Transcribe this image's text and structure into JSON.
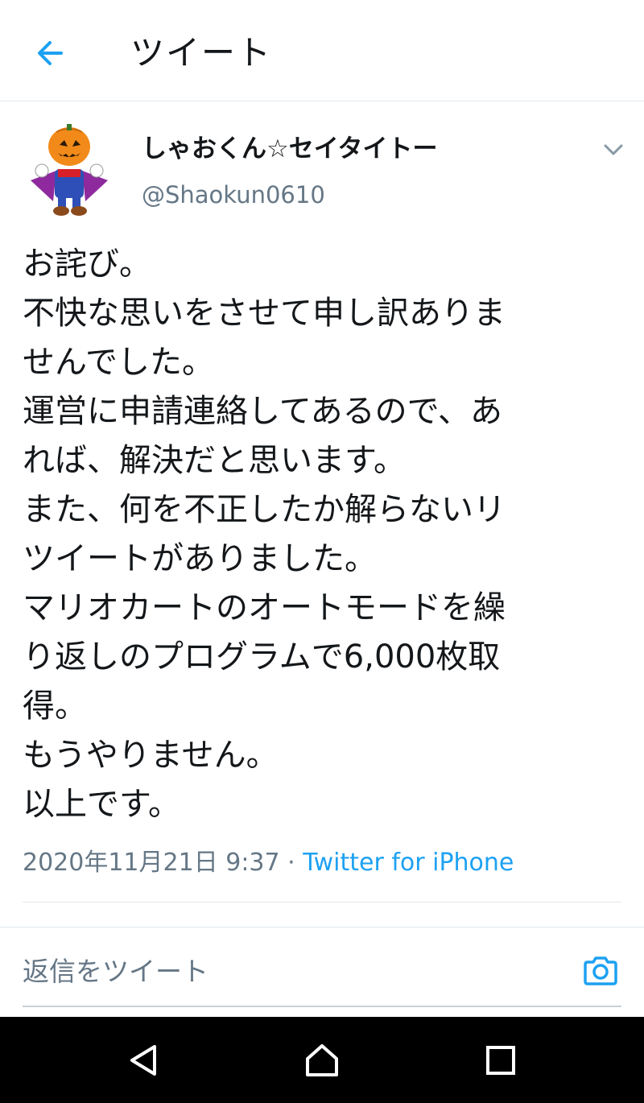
{
  "header": {
    "back_icon": "arrow-left-icon",
    "title": "ツイート"
  },
  "colors": {
    "accent": "#1da1f2",
    "secondary_text": "#657786",
    "divider": "#e1e8ed",
    "navbar": "#000000"
  },
  "tweet": {
    "avatar_icon": "pumpkin-mario-avatar",
    "display_name": "しゃおくん☆セイタイトー",
    "username": "@Shaokun0610",
    "menu_icon": "chevron-down-icon",
    "lines": [
      "お詫び。",
      "不快な思いをさせて申し訳ありま",
      "せんでした。",
      "運営に申請連絡してあるので、あ",
      "れば、解決だと思います。",
      "また、何を不正したか解らないリ",
      "ツイートがありました。",
      "マリオカートのオートモードを繰",
      "り返しのプログラムで6,000枚取",
      "得。",
      "もうやりません。",
      "以上です。"
    ],
    "timestamp": "2020年11月21日 9:37",
    "separator": "·",
    "source": "Twitter for iPhone"
  },
  "reply": {
    "placeholder": "返信をツイート",
    "camera_icon": "camera-icon"
  },
  "navbar": {
    "back_icon": "triangle-back-icon",
    "home_icon": "home-icon",
    "recents_icon": "square-recents-icon"
  }
}
